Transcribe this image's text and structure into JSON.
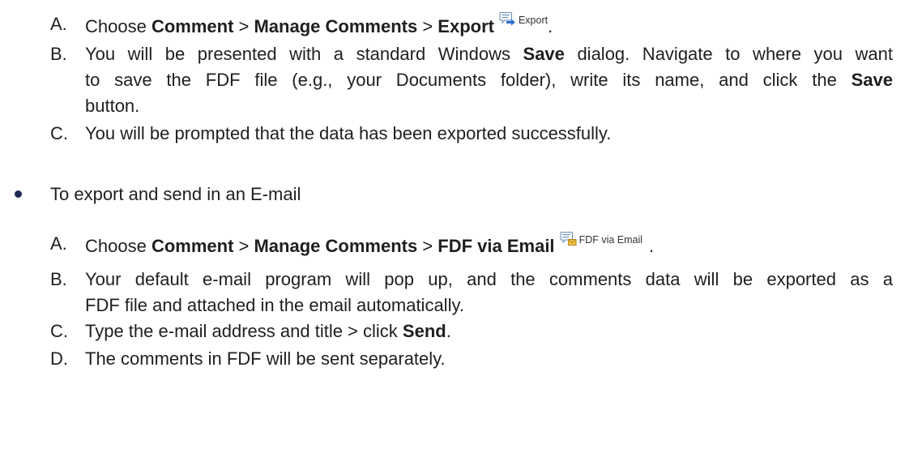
{
  "export_steps": {
    "a": {
      "marker": "A.",
      "pre": "Choose ",
      "bold1": "Comment",
      "sep1": " > ",
      "bold2": "Manage Comments",
      "sep2": " > ",
      "bold3": "Export",
      "icon": "comment-export-icon",
      "icon_label": "Export",
      "end": "."
    },
    "b": {
      "marker": "B.",
      "line1_pre": "You will be presented with a standard Windows ",
      "line1_bold": "Save",
      "line1_post": " dialog. Navigate to where you want",
      "line2_pre": "to save the FDF file (e.g., your Documents folder), write its name, and click the ",
      "line2_bold": "Save",
      "line3": "button."
    },
    "c": {
      "marker": "C.",
      "text": "You will be prompted that the data has been exported successfully."
    }
  },
  "email_section": {
    "bullet_text": "To export and send in an E-mail",
    "a": {
      "marker": "A.",
      "pre": "Choose ",
      "bold1": "Comment",
      "sep1": " > ",
      "bold2": "Manage Comments",
      "sep2": " > ",
      "bold3": "FDF via Email",
      "icon": "comment-email-icon",
      "icon_label": "FDF via Email",
      "end": "."
    },
    "b": {
      "marker": "B.",
      "line1": "Your default e-mail program will pop up, and the comments data will be exported as a",
      "line2": "FDF file and attached in the email automatically."
    },
    "c": {
      "marker": "C.",
      "pre": "Type the e-mail address and title > click ",
      "bold": "Send",
      "end": "."
    },
    "d": {
      "marker": "D.",
      "text": "The comments in FDF will be sent separately."
    }
  },
  "colors": {
    "text": "#1f1f1f",
    "bullet": "#1c2c50",
    "icon_stroke": "#6a8db4",
    "icon_fill": "#f4f7fb",
    "icon_blue": "#2e6fd0",
    "envelope_fill": "#f0c04a",
    "envelope_stroke": "#b8871c"
  }
}
